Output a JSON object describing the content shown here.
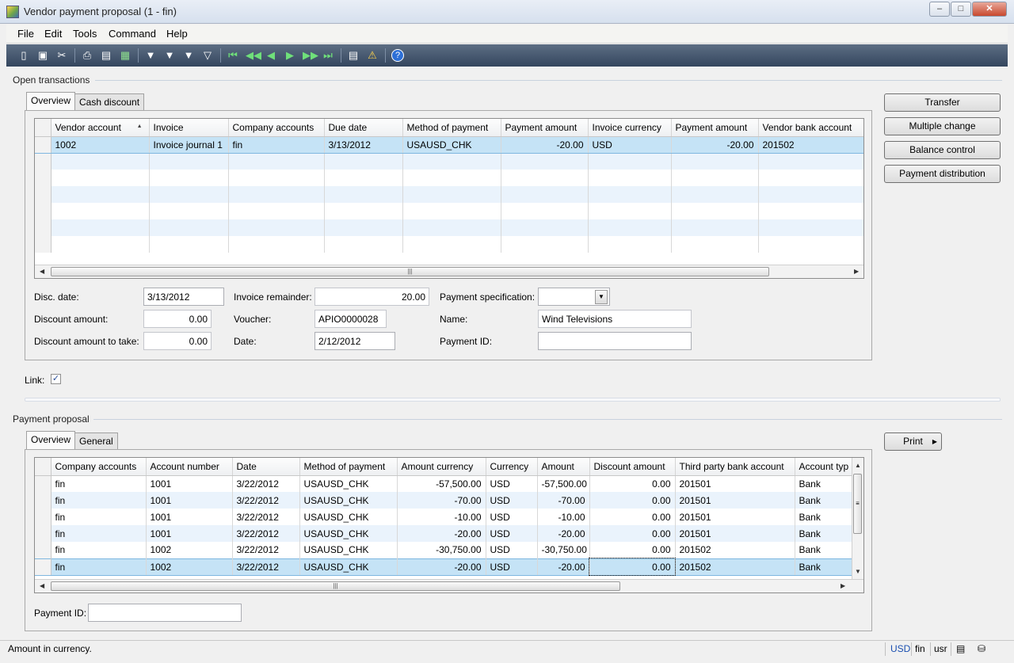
{
  "window": {
    "title": "Vendor payment proposal (1 - fin)",
    "min": "–",
    "max": "□",
    "close": "✕"
  },
  "menu": [
    "File",
    "Edit",
    "Tools",
    "Command",
    "Help"
  ],
  "toolbar_icons": [
    "new-icon",
    "save-icon",
    "delete-icon",
    "print-icon",
    "print-preview-icon",
    "export-excel-icon",
    "filter-icon",
    "filter-by-selection-icon",
    "advanced-filter-icon",
    "remove-filter-icon",
    "first-record-icon",
    "previous-page-icon",
    "previous-record-icon",
    "next-record-icon",
    "next-page-icon",
    "last-record-icon",
    "document-handling-icon",
    "alert-icon",
    "help-icon"
  ],
  "open_transactions": {
    "group_label": "Open transactions",
    "tabs": [
      "Overview",
      "Cash discount"
    ],
    "columns": [
      "Vendor account",
      "Invoice",
      "Company accounts",
      "Due date",
      "Method of payment",
      "Payment amount",
      "Invoice currency",
      "Payment amount",
      "Vendor bank account"
    ],
    "rows": [
      [
        "1002",
        "Invoice journal 1",
        "fin",
        "3/13/2012",
        "USAUSD_CHK",
        "-20.00",
        "USD",
        "-20.00",
        "201502"
      ]
    ],
    "fields": {
      "disc_date_label": "Disc. date:",
      "disc_date": "3/13/2012",
      "discount_amount_label": "Discount amount:",
      "discount_amount": "0.00",
      "discount_to_take_label": "Discount amount to take:",
      "discount_to_take": "0.00",
      "invoice_remainder_label": "Invoice remainder:",
      "invoice_remainder": "20.00",
      "voucher_label": "Voucher:",
      "voucher": "APIO0000028",
      "date_label": "Date:",
      "date": "2/12/2012",
      "payment_spec_label": "Payment specification:",
      "payment_spec": "",
      "name_label": "Name:",
      "name": "Wind Televisions",
      "payment_id_label": "Payment ID:",
      "payment_id": ""
    },
    "buttons": [
      "Transfer",
      "Multiple change",
      "Balance control",
      "Payment distribution"
    ]
  },
  "link": {
    "label": "Link:",
    "checked": true
  },
  "payment_proposal": {
    "group_label": "Payment proposal",
    "tabs": [
      "Overview",
      "General"
    ],
    "columns": [
      "Company accounts",
      "Account number",
      "Date",
      "Method of payment",
      "Amount currency",
      "Currency",
      "Amount",
      "Discount amount",
      "Third party bank account",
      "Account typ"
    ],
    "rows": [
      [
        "fin",
        "1001",
        "3/22/2012",
        "USAUSD_CHK",
        "-57,500.00",
        "USD",
        "-57,500.00",
        "0.00",
        "201501",
        "Bank"
      ],
      [
        "fin",
        "1001",
        "3/22/2012",
        "USAUSD_CHK",
        "-70.00",
        "USD",
        "-70.00",
        "0.00",
        "201501",
        "Bank"
      ],
      [
        "fin",
        "1001",
        "3/22/2012",
        "USAUSD_CHK",
        "-10.00",
        "USD",
        "-10.00",
        "0.00",
        "201501",
        "Bank"
      ],
      [
        "fin",
        "1001",
        "3/22/2012",
        "USAUSD_CHK",
        "-20.00",
        "USD",
        "-20.00",
        "0.00",
        "201501",
        "Bank"
      ],
      [
        "fin",
        "1002",
        "3/22/2012",
        "USAUSD_CHK",
        "-30,750.00",
        "USD",
        "-30,750.00",
        "0.00",
        "201502",
        "Bank"
      ],
      [
        "fin",
        "1002",
        "3/22/2012",
        "USAUSD_CHK",
        "-20.00",
        "USD",
        "-20.00",
        "0.00",
        "201502",
        "Bank"
      ]
    ],
    "payment_id_label": "Payment ID:",
    "payment_id": "",
    "print_button": "Print"
  },
  "status": {
    "message": "Amount in currency.",
    "currency": "USD",
    "company": "fin",
    "layer": "usr"
  }
}
